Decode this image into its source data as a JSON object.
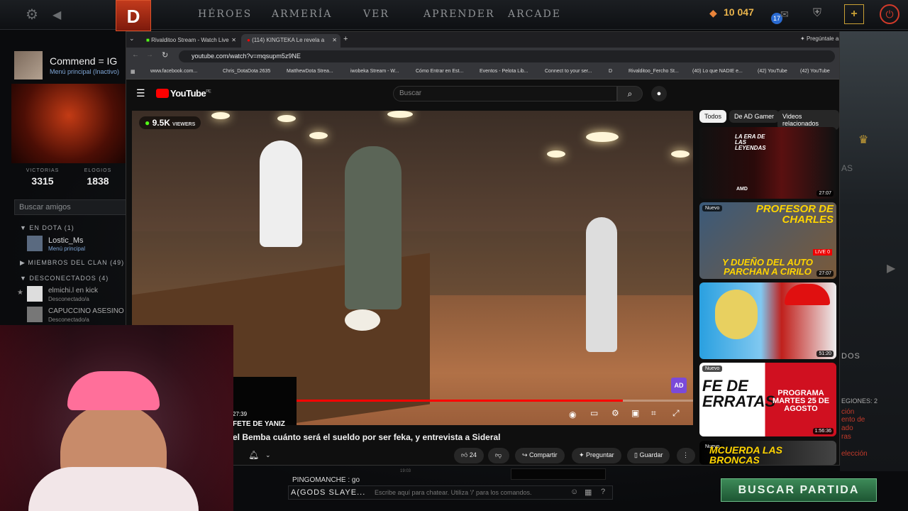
{
  "dota": {
    "nav": [
      "HÉROES",
      "ARMERÍA",
      "VER",
      "APRENDER",
      "ARCADE"
    ],
    "gold": "10 047",
    "level": "17",
    "logo": "D"
  },
  "profile": {
    "name": "Commend = IG",
    "status": "Menú principal (Inactivo)",
    "wins_label": "VICTORIAS",
    "wins": "3315",
    "commends_label": "ELOGIOS",
    "commends": "1838"
  },
  "friends": {
    "search_placeholder": "Buscar amigos",
    "in_dota": "EN DOTA",
    "in_dota_count": "(1)",
    "f1_name": "Lostic_Ms",
    "f1_status": "Menú principal",
    "clan": "MIEMBROS DEL CLAN",
    "clan_count": "(49)",
    "offline": "DESCONECTADOS",
    "offline_count": "(4)",
    "f2_name": "elmichi.l en kick",
    "f2_status": "Desconectado/a",
    "f3_name": "CAPUCCINO ASESINO",
    "f3_status": "Desconectado/a"
  },
  "browser": {
    "tabs": [
      "Rivalditoo Stream - Watch Live",
      "(114) KINGTEKA Le revela a"
    ],
    "ask": "Pregúntale a",
    "url": "youtube.com/watch?v=mqsupm5z9NE",
    "bookmarks": [
      "www.facebook.com...",
      "Chris_DotaDota 2635",
      "MatthewDota Strea...",
      "iwobeka Stream - W...",
      "Cómo Entrar en Est...",
      "Eventos - Pelota Lib...",
      "Connect to your ser...",
      "D",
      "Rivalditoo_Fercho St...",
      "(40) Lo que NADIE e...",
      "(42) YouTube",
      "(42) YouTube"
    ]
  },
  "youtube": {
    "brand": "YouTube",
    "country": "PE",
    "search_placeholder": "Buscar",
    "viewers": "9.5K",
    "viewers_label": "VIEWERS",
    "progress": 0.875,
    "title": "el Bemba cuánto será el sueldo por ser feka, y entrevista a Sideral",
    "cap_time": "27:39",
    "cap_text": "FETE DE YANIZ",
    "likes": "24",
    "share": "Compartir",
    "ask": "Preguntar",
    "save": "Guardar",
    "watermark": "AD",
    "chips": [
      "Todos",
      "De AD Gamer",
      "Videos relacionados"
    ],
    "sidebar": [
      {
        "title": "LA ERA DE LAS LEYENDAS",
        "badge": "",
        "duration": "27:07",
        "brand": "AMD"
      },
      {
        "title": "PROFESOR DE CHARLES",
        "sub": "Y DUEÑO DEL AUTO PARCHAN A CIRILO",
        "badge": "Nuevo",
        "duration": "27:07",
        "live": "LIVE 0"
      },
      {
        "title": "",
        "badge": "",
        "duration": "51:20"
      },
      {
        "title": "FE DE ERRATAS",
        "sub": "PROGRAMA MARTES 25 DE AGOSTO",
        "badge": "Nuevo",
        "duration": "1:56:36"
      },
      {
        "title": "MCUERDA LAS BRONCAS",
        "badge": "Nuevo",
        "duration": ""
      }
    ]
  },
  "right": {
    "t1": "AS",
    "t2": "DOS",
    "t3": "EGIONES: 2",
    "t4": "ción",
    "t5": "ento de",
    "t6": "ado",
    "t7": "ras",
    "t8": "elección"
  },
  "chat": {
    "line1": "PINGOMANCHE : go",
    "timestamp": "19:03",
    "name": "A(GODS SLAYE...",
    "placeholder": "Escribe aquí para chatear. Utiliza '/' para los comandos."
  },
  "find_match": "BUSCAR PARTIDA"
}
